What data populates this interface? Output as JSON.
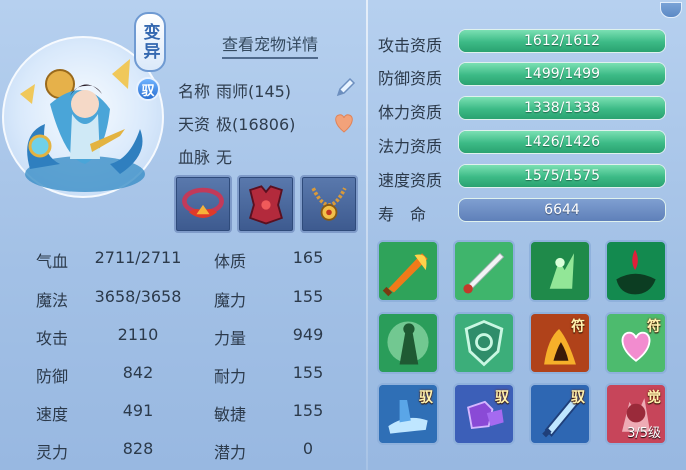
{
  "pet": {
    "tag_mutation": "变异",
    "tag_rider": "驭",
    "detail_link": "查看宠物详情",
    "name_label": "名称",
    "name_value": "雨师(145)",
    "talent_label": "天资",
    "talent_value": "极(16806)",
    "bloodline_label": "血脉",
    "bloodline_value": "无"
  },
  "stats_left": [
    {
      "label": "气血",
      "value": "2711/2711"
    },
    {
      "label": "魔法",
      "value": "3658/3658"
    },
    {
      "label": "攻击",
      "value": "2110"
    },
    {
      "label": "防御",
      "value": "842"
    },
    {
      "label": "速度",
      "value": "491"
    },
    {
      "label": "灵力",
      "value": "828"
    }
  ],
  "stats_right": [
    {
      "label": "体质",
      "value": "165"
    },
    {
      "label": "魔力",
      "value": "155"
    },
    {
      "label": "力量",
      "value": "949"
    },
    {
      "label": "耐力",
      "value": "155"
    },
    {
      "label": "敏捷",
      "value": "155"
    },
    {
      "label": "潜力",
      "value": "0"
    }
  ],
  "aptitudes": [
    {
      "label": "攻击资质",
      "value": "1612/1612",
      "fill": 1.0
    },
    {
      "label": "防御资质",
      "value": "1499/1499",
      "fill": 1.0
    },
    {
      "label": "体力资质",
      "value": "1338/1338",
      "fill": 1.0
    },
    {
      "label": "法力资质",
      "value": "1426/1426",
      "fill": 1.0
    },
    {
      "label": "速度资质",
      "value": "1575/1575",
      "fill": 1.0
    }
  ],
  "lifespan": {
    "label": "寿　命",
    "value": "6644"
  },
  "skills": [
    {
      "icon": "flame-sword-icon",
      "badge": "",
      "level": ""
    },
    {
      "icon": "white-blade-icon",
      "badge": "",
      "level": ""
    },
    {
      "icon": "green-spirit-icon",
      "badge": "",
      "level": ""
    },
    {
      "icon": "blood-shadow-icon",
      "badge": "",
      "level": ""
    },
    {
      "icon": "green-warrior-icon",
      "badge": "",
      "level": ""
    },
    {
      "icon": "shield-rune-icon",
      "badge": "",
      "level": ""
    },
    {
      "icon": "fire-spirit-icon",
      "badge": "符",
      "level": ""
    },
    {
      "icon": "pink-heart-icon",
      "badge": "符",
      "level": ""
    },
    {
      "icon": "blue-boot-icon",
      "badge": "驭",
      "level": ""
    },
    {
      "icon": "purple-fist-icon",
      "badge": "驭",
      "level": ""
    },
    {
      "icon": "blue-sword-icon",
      "badge": "驭",
      "level": ""
    },
    {
      "icon": "red-awaken-icon",
      "badge": "觉",
      "level": "3/5级"
    }
  ],
  "equipment": [
    {
      "icon": "red-collar-icon"
    },
    {
      "icon": "red-armor-icon"
    },
    {
      "icon": "gold-necklace-icon"
    }
  ],
  "colors": {
    "aptitude_fill": "#3cba86",
    "panel_bg": "#a9c6e8",
    "text": "#2c3a4b"
  }
}
